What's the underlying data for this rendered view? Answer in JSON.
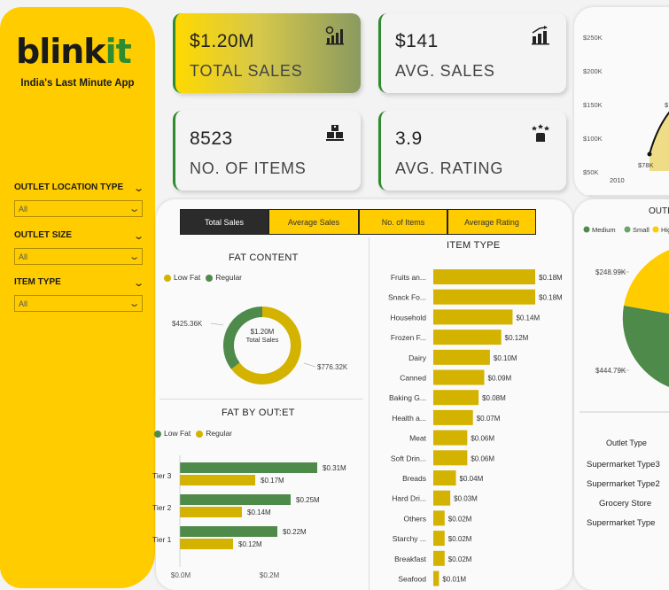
{
  "sidebar": {
    "logo_main": "blink",
    "logo_accent": "it",
    "tagline": "India's Last Minute App",
    "filters": [
      {
        "title": "OUTLET LOCATION TYPE",
        "value": "All"
      },
      {
        "title": "OUTLET SIZE",
        "value": "All"
      },
      {
        "title": "ITEM TYPE",
        "value": "All"
      }
    ]
  },
  "kpis": [
    {
      "value": "$1.20M",
      "label": "TOTAL SALES",
      "icon": "sales-chart-icon"
    },
    {
      "value": "$141",
      "label": "AVG. SALES",
      "icon": "bar-growth-icon"
    },
    {
      "value": "8523",
      "label": "NO. OF ITEMS",
      "icon": "boxes-icon"
    },
    {
      "value": "3.9",
      "label": "AVG. RATING",
      "icon": "rating-hand-icon"
    }
  ],
  "tabs": [
    "Total Sales",
    "Average Sales",
    "No. of Items",
    "Average Rating"
  ],
  "active_tab": 0,
  "colors": {
    "yellow": "#ffcc00",
    "bar_yellow": "#d4b200",
    "green": "#4e8a4a",
    "dark": "#2b2b2b"
  },
  "fat_content": {
    "title": "FAT CONTENT",
    "legend": [
      "Low Fat",
      "Regular"
    ],
    "center_value": "$1.20M",
    "center_label": "Total Sales",
    "chart_data": {
      "type": "pie",
      "categories": [
        "Low Fat",
        "Regular"
      ],
      "values": [
        776.32,
        425.36
      ],
      "labels": [
        "$776.32K",
        "$425.36K"
      ]
    }
  },
  "fat_by_outlet": {
    "title": "FAT BY OUT:ET",
    "legend": [
      "Low Fat",
      "Regular"
    ],
    "x_ticks": [
      "$0.0M",
      "$0.2M"
    ],
    "chart_data": {
      "type": "bar",
      "orientation": "horizontal",
      "categories": [
        "Tier 3",
        "Tier 2",
        "Tier 1"
      ],
      "series": [
        {
          "name": "Low Fat",
          "values": [
            0.31,
            0.25,
            0.22
          ],
          "labels": [
            "$0.31M",
            "$0.25M",
            "$0.22M"
          ]
        },
        {
          "name": "Regular",
          "values": [
            0.17,
            0.14,
            0.12
          ],
          "labels": [
            "$0.17M",
            "$0.14M",
            "$0.12M"
          ]
        }
      ],
      "xlim": [
        0,
        0.4
      ]
    }
  },
  "item_type": {
    "title": "ITEM TYPE",
    "chart_data": {
      "type": "bar",
      "orientation": "horizontal",
      "categories": [
        "Fruits an...",
        "Snack Fo...",
        "Household",
        "Frozen F...",
        "Dairy",
        "Canned",
        "Baking G...",
        "Health a...",
        "Meat",
        "Soft Drin...",
        "Breads",
        "Hard Dri...",
        "Others",
        "Starchy ...",
        "Breakfast",
        "Seafood"
      ],
      "values": [
        0.18,
        0.18,
        0.14,
        0.12,
        0.1,
        0.09,
        0.08,
        0.07,
        0.06,
        0.06,
        0.04,
        0.03,
        0.02,
        0.02,
        0.02,
        0.01
      ],
      "labels": [
        "$0.18M",
        "$0.18M",
        "$0.14M",
        "$0.12M",
        "$0.10M",
        "$0.09M",
        "$0.08M",
        "$0.07M",
        "$0.06M",
        "$0.06M",
        "$0.04M",
        "$0.03M",
        "$0.02M",
        "$0.02M",
        "$0.02M",
        "$0.01M"
      ]
    }
  },
  "outlet_establishment": {
    "y_ticks": [
      "$250K",
      "$200K",
      "$150K",
      "$100K",
      "$50K"
    ],
    "x_tick": "2010",
    "point_label": "$78K",
    "chart_data": {
      "type": "line",
      "x": [
        2010
      ],
      "y": [
        78
      ],
      "ylim": [
        0,
        250
      ]
    }
  },
  "outlet_size": {
    "title": "OUTL",
    "legend": [
      "Medium",
      "Small",
      "Hig"
    ],
    "chart_data": {
      "type": "pie",
      "categories": [
        "Medium",
        "Small"
      ],
      "values": [
        248.99,
        444.79
      ],
      "labels": [
        "$248.99K",
        "$444.79K"
      ]
    }
  },
  "outlet_table": {
    "header": "Outlet Type",
    "rows": [
      "Supermarket Type3",
      "Supermarket Type2",
      "Grocery Store",
      "Supermarket Type"
    ]
  }
}
